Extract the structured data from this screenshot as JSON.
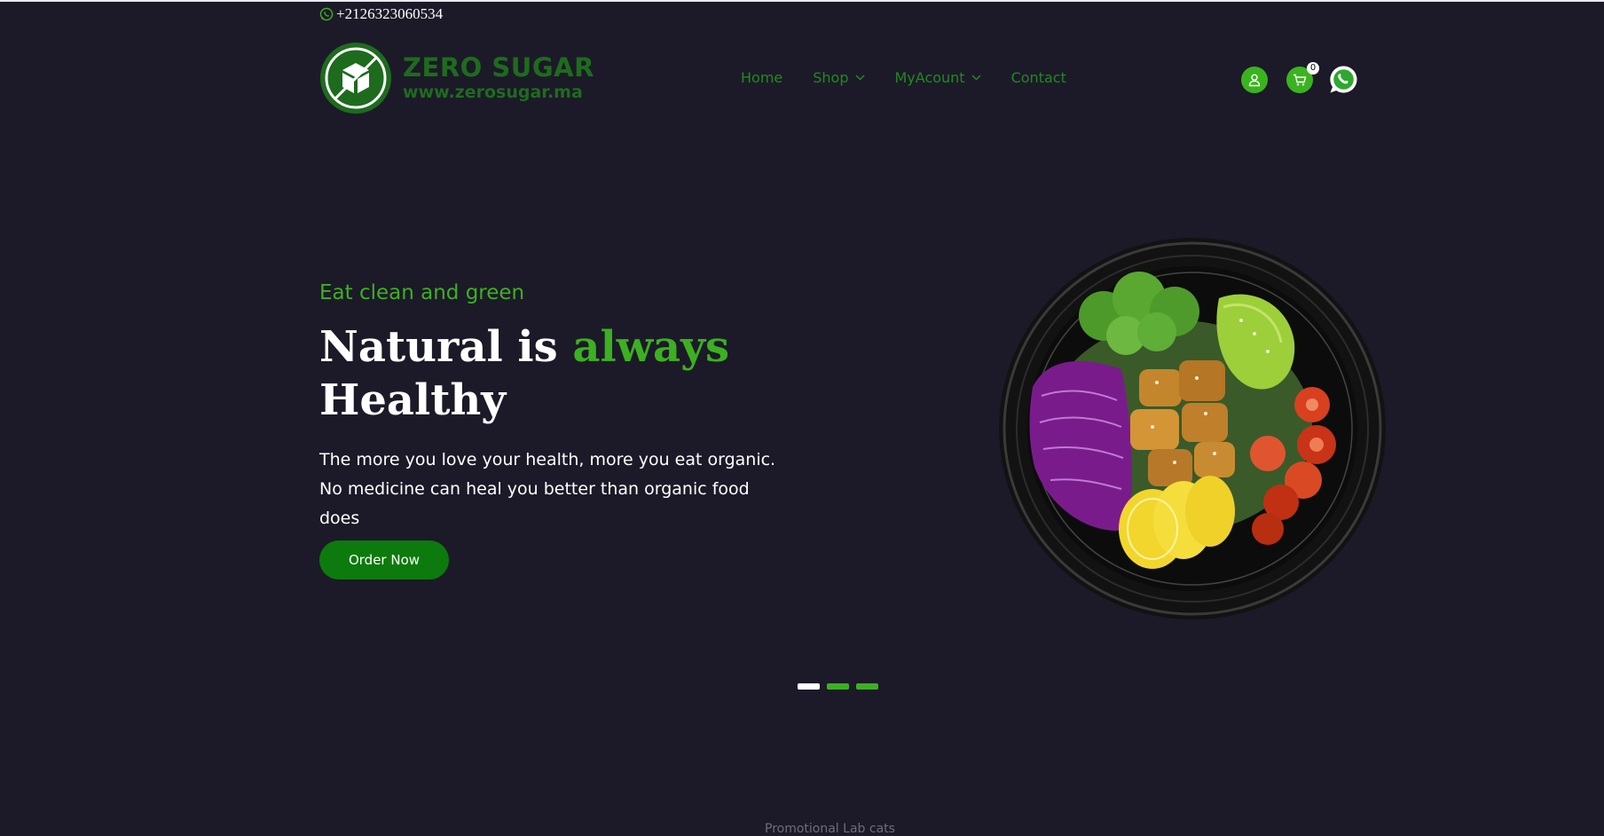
{
  "topbar": {
    "phone": "+2126323060534"
  },
  "brand": {
    "name": "ZERO SUGAR",
    "url": "www.zerosugar.ma"
  },
  "nav": {
    "items": [
      {
        "label": "Home"
      },
      {
        "label": "Shop"
      },
      {
        "label": "MyAcount"
      },
      {
        "label": "Contact"
      }
    ]
  },
  "header_actions": {
    "cart_count": "0",
    "icons": [
      "user-icon",
      "cart-icon",
      "whatsapp-icon"
    ]
  },
  "hero": {
    "tagline": "Eat clean and green",
    "title_part1": "Natural is ",
    "title_accent": "always",
    "title_part2": "Healthy",
    "description": "The more you love your health, more you eat organic. No medicine can heal you better than organic food does",
    "cta_label": "Order Now"
  },
  "slider": {
    "slide_count": 3,
    "active_index": 0
  },
  "footer_peek": {
    "text": "Promotional Lab cats"
  },
  "colors": {
    "background": "#1c1a28",
    "accent_green": "#3cb021",
    "button_green": "#0c7a0c",
    "logo_green": "#1e6b1e",
    "nav_green": "#1f8a1f"
  }
}
